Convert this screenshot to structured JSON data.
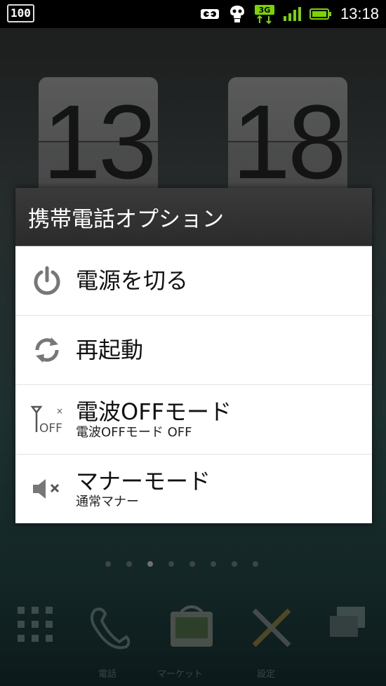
{
  "status_bar": {
    "battery_percent": "100",
    "network_type": "3G",
    "time": "13:18",
    "icons": [
      "voicemail-icon",
      "security-icon",
      "3g-icon",
      "signal-icon",
      "battery-icon"
    ],
    "accent_color": "#7cd300"
  },
  "clock_widget": {
    "hour": "13",
    "minute": "18"
  },
  "dialog": {
    "title": "携帯電話オプション",
    "options": [
      {
        "icon": "power-icon",
        "title": "電源を切る",
        "subtitle": ""
      },
      {
        "icon": "restart-icon",
        "title": "再起動",
        "subtitle": ""
      },
      {
        "icon": "radio-off-icon",
        "title": "電波OFFモード",
        "subtitle": "電波OFFモード OFF"
      },
      {
        "icon": "mute-icon",
        "title": "マナーモード",
        "subtitle": "通常マナー"
      }
    ]
  },
  "dock": {
    "labels": [
      "電話",
      "マーケット",
      "設定"
    ]
  }
}
